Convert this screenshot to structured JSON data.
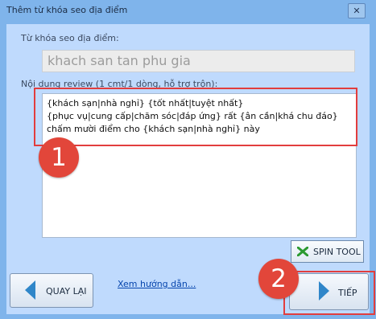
{
  "window": {
    "title": "Thêm từ khóa seo địa điểm",
    "close_glyph": "✕"
  },
  "form": {
    "keyword_label": "Từ khóa seo địa điểm:",
    "keyword_value": "khach san tan phu gia",
    "review_label": "Nội dung review (1 cmt/1 dòng, hỗ trợ trộn):",
    "review_lines": [
      "{khách sạn|nhà nghỉ} {tốt nhất|tuyệt nhất}",
      "{phục vụ|cung cấp|chăm sóc|đáp ứng} rất {ân cần|khá chu đáo}",
      "chấm mười điểm cho {khách sạn|nhà nghỉ} này"
    ]
  },
  "annotations": {
    "badge_1": "1",
    "badge_2": "2",
    "highlight_color": "#e23d3d"
  },
  "buttons": {
    "spin_label": "SPIN TOOL",
    "spin_icon": "spin-x-icon",
    "back_label": "QUAY LẠI",
    "back_icon": "left-arrow-icon",
    "next_label": "TIẾP",
    "next_icon": "right-arrow-icon"
  },
  "help_link": "Xem hướng dẫn..."
}
